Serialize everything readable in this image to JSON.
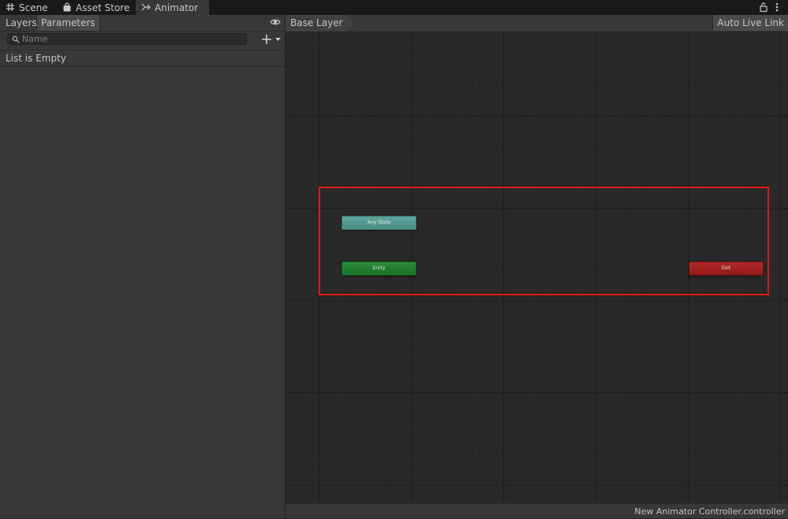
{
  "tabs": [
    {
      "label": "Scene",
      "icon": "grid-icon"
    },
    {
      "label": "Asset Store",
      "icon": "bag-icon"
    },
    {
      "label": "Animator",
      "icon": "animator-icon",
      "active": true
    }
  ],
  "window_controls": {
    "lock_icon": "lock-icon",
    "menu_icon": "kebab-menu-icon"
  },
  "left_panel": {
    "tabs": [
      {
        "label": "Layers"
      },
      {
        "label": "Parameters",
        "active": true
      }
    ],
    "search": {
      "placeholder": "Name",
      "value": ""
    },
    "empty_message": "List is Empty"
  },
  "graph": {
    "breadcrumb": "Base Layer",
    "live_link_label": "Auto Live Link",
    "nodes": {
      "any_state": "Any State",
      "entry": "Entry",
      "exit": "Exit"
    }
  },
  "status": {
    "file": "New Animator Controller.controller"
  },
  "colors": {
    "any_state": "#55998f",
    "entry": "#237e30",
    "exit": "#a12222",
    "highlight": "#e01818"
  }
}
